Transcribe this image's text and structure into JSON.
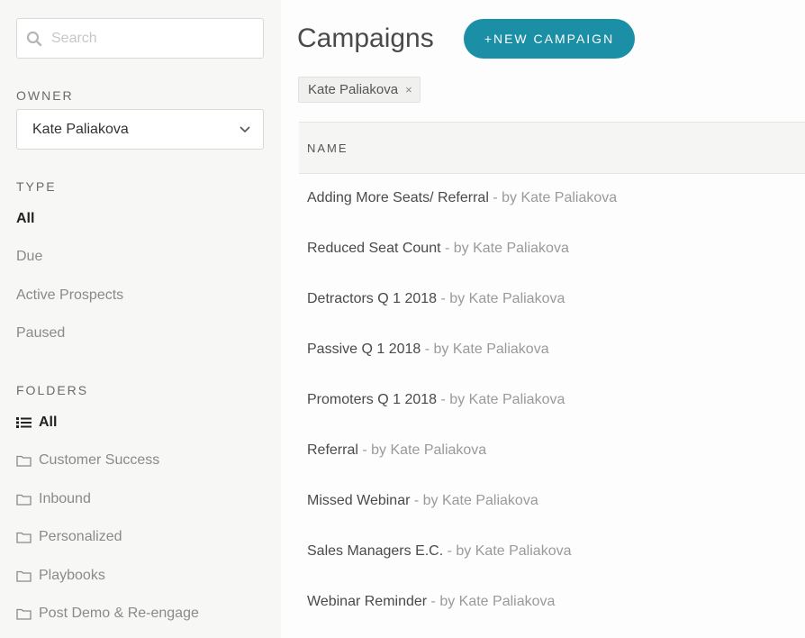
{
  "search": {
    "placeholder": "Search",
    "value": ""
  },
  "owner": {
    "label": "OWNER",
    "selected": "Kate Paliakova"
  },
  "type": {
    "label": "TYPE",
    "items": [
      "All",
      "Due",
      "Active Prospects",
      "Paused"
    ],
    "active": "All"
  },
  "folders": {
    "label": "FOLDERS",
    "items": [
      "All",
      "Customer Success",
      "Inbound",
      "Personalized",
      "Playbooks",
      "Post Demo & Re-engage"
    ],
    "active": "All"
  },
  "main": {
    "title": "Campaigns",
    "new_button": "+NEW CAMPAIGN",
    "filter_chip": "Kate Paliakova",
    "filter_chip_close": "×",
    "column_header": "NAME"
  },
  "campaigns": [
    {
      "name": "Adding More Seats/ Referral",
      "by": " - by Kate Paliakova"
    },
    {
      "name": "Reduced Seat Count",
      "by": " - by Kate Paliakova"
    },
    {
      "name": "Detractors Q 1 2018",
      "by": " - by Kate Paliakova"
    },
    {
      "name": "Passive Q 1 2018",
      "by": " - by Kate Paliakova"
    },
    {
      "name": "Promoters Q 1 2018",
      "by": " - by Kate Paliakova"
    },
    {
      "name": "Referral",
      "by": " - by Kate Paliakova"
    },
    {
      "name": "Missed Webinar",
      "by": " - by Kate Paliakova"
    },
    {
      "name": "Sales Managers E.C.",
      "by": " - by Kate Paliakova"
    },
    {
      "name": "Webinar Reminder",
      "by": " - by Kate Paliakova"
    }
  ],
  "colors": {
    "accent": "#1a8fa6",
    "sidebar_bg": "#f7f7f5"
  }
}
